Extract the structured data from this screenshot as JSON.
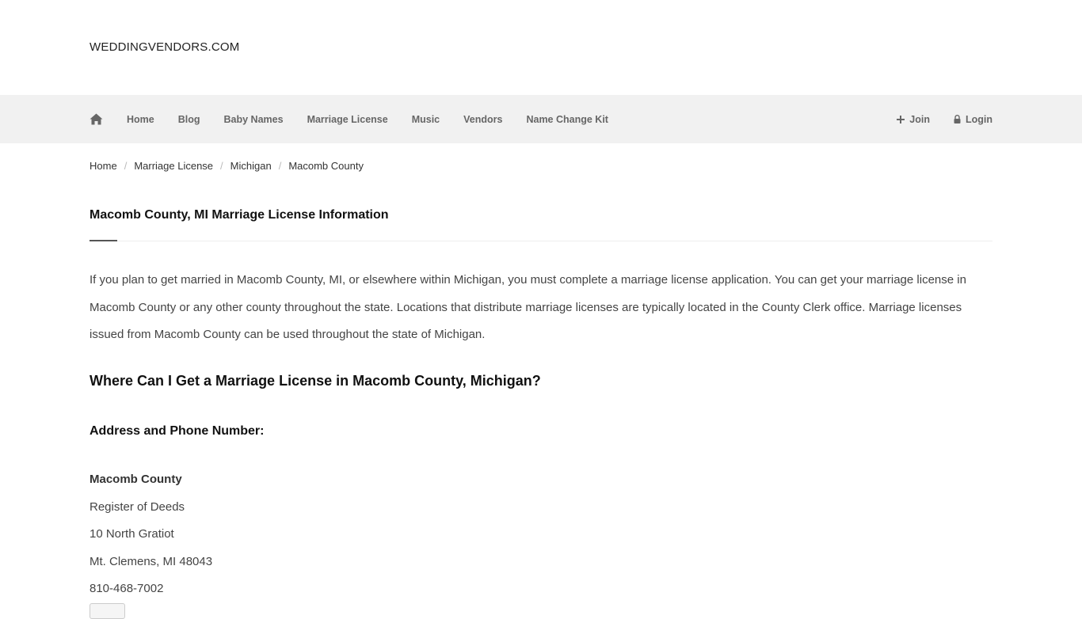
{
  "site": {
    "logo": "WEDDINGVENDORS.COM"
  },
  "nav": {
    "items": [
      "Home",
      "Blog",
      "Baby Names",
      "Marriage License",
      "Music",
      "Vendors",
      "Name Change Kit"
    ],
    "join": "Join",
    "login": "Login"
  },
  "breadcrumb": [
    "Home",
    "Marriage License",
    "Michigan",
    "Macomb County"
  ],
  "page": {
    "title": "Macomb County, MI Marriage License Information",
    "intro": "If you plan to get married in Macomb County, MI, or elsewhere within Michigan, you must complete a marriage license application. You can get your marriage license in Macomb County or any other county throughout the state. Locations that distribute marriage licenses are typically located in the County Clerk office. Marriage licenses issued from Macomb County can be used throughout the state of Michigan.",
    "where_heading": "Where Can I Get a Marriage License in Macomb County, Michigan?",
    "address_heading": "Address and Phone Number:"
  },
  "office": {
    "name": "Macomb County",
    "department": "Register of Deeds",
    "street": "10 North Gratiot",
    "city": "Mt. Clemens, MI 48043",
    "phone": "810-468-7002"
  },
  "colors": {
    "navbar_bg": "#f1f1f1",
    "nav_text": "#666666",
    "body_text": "#444444"
  }
}
